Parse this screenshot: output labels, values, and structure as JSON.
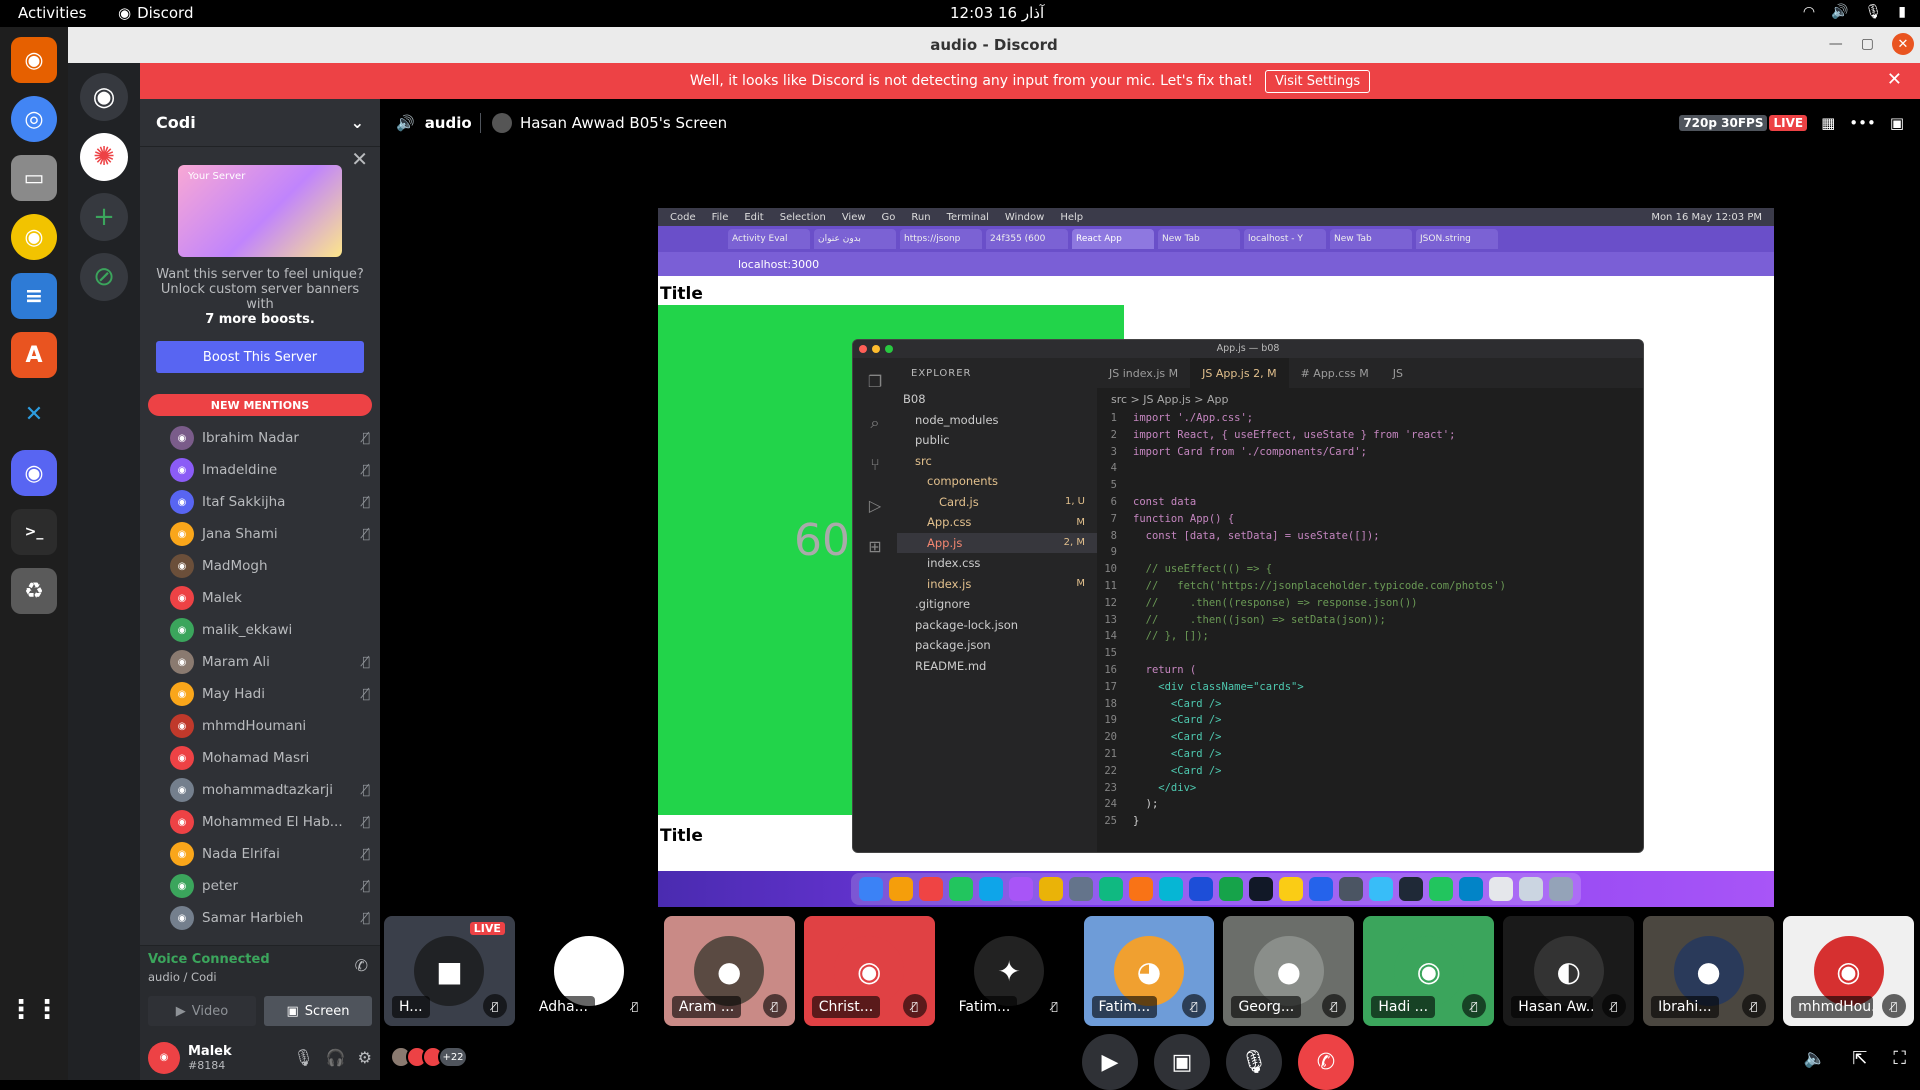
{
  "topbar": {
    "activities": "Activities",
    "app": "Discord",
    "clock": "12:03  16 آذار"
  },
  "window": {
    "title": "audio - Discord"
  },
  "notice": {
    "text": "Well, it looks like Discord is not detecting any input from your mic. Let's fix that!",
    "button": "Visit Settings"
  },
  "server": {
    "name": "Codi"
  },
  "boost": {
    "art_label": "Your Server",
    "line1": "Want this server to feel unique?",
    "line2": "Unlock custom server banners with",
    "line3": "7 more boosts.",
    "button": "Boost This Server"
  },
  "mentions": {
    "label": "NEW MENTIONS"
  },
  "users": [
    {
      "name": "Ibrahim Nadar",
      "color": "#7a5c8a",
      "muted": true
    },
    {
      "name": "Imadeldine",
      "color": "#8b5cf6",
      "muted": true
    },
    {
      "name": "Itaf Sakkijha",
      "color": "#5865f2",
      "muted": true
    },
    {
      "name": "Jana Shami",
      "color": "#faa61a",
      "muted": true
    },
    {
      "name": "MadMogh",
      "color": "#6b4f3a",
      "muted": false
    },
    {
      "name": "Malek",
      "color": "#ed4245",
      "muted": false
    },
    {
      "name": "malik_ekkawi",
      "color": "#3ba55c",
      "muted": false
    },
    {
      "name": "Maram Ali",
      "color": "#8a7a70",
      "muted": true
    },
    {
      "name": "May Hadi",
      "color": "#faa61a",
      "muted": true
    },
    {
      "name": "mhmdHoumani",
      "color": "#c0392b",
      "muted": false
    },
    {
      "name": "Mohamad Masri",
      "color": "#ed4245",
      "muted": false
    },
    {
      "name": "mohammadtazkarji",
      "color": "#747f8d",
      "muted": true
    },
    {
      "name": "Mohammed El Hab...",
      "color": "#ed4245",
      "muted": true
    },
    {
      "name": "Nada Elrifai",
      "color": "#faa61a",
      "muted": true
    },
    {
      "name": "peter",
      "color": "#3ba55c",
      "muted": true
    },
    {
      "name": "Samar Harbieh",
      "color": "#747f8d",
      "muted": true
    }
  ],
  "voice": {
    "status": "Voice Connected",
    "channel": "audio / Codi",
    "video": "Video",
    "screen": "Screen"
  },
  "me": {
    "name": "Malek",
    "tag": "#8184"
  },
  "stage": {
    "channel": "audio",
    "screen_title": "Hasan Awwad B05's Screen",
    "quality": "720p 30FPS",
    "live": "LIVE"
  },
  "shared": {
    "mac_menu": [
      "Code",
      "File",
      "Edit",
      "Selection",
      "View",
      "Go",
      "Run",
      "Terminal",
      "Window",
      "Help"
    ],
    "mac_time": "Mon 16 May  12:03 PM",
    "tabs": [
      "Activity Eval",
      "بدون عنوان",
      "https://jsonp",
      "24f355 (600",
      "React App",
      "New Tab",
      "localhost - Y",
      "New Tab",
      "JSON.string"
    ],
    "url": "localhost:3000",
    "page_title": "Title",
    "green_text": "600",
    "vscode_title": "App.js — b08",
    "explorer_header": "EXPLORER",
    "files": [
      {
        "name": "B08",
        "indent": 0,
        "badge": "",
        "color": "#ccc"
      },
      {
        "name": "node_modules",
        "indent": 1,
        "badge": "",
        "color": "#ccc"
      },
      {
        "name": "public",
        "indent": 1,
        "badge": "",
        "color": "#ccc"
      },
      {
        "name": "src",
        "indent": 1,
        "badge": "",
        "color": "#e2c08d"
      },
      {
        "name": "components",
        "indent": 2,
        "badge": "",
        "color": "#e2c08d"
      },
      {
        "name": "Card.js",
        "indent": 3,
        "badge": "1, U",
        "color": "#e2c08d"
      },
      {
        "name": "App.css",
        "indent": 2,
        "badge": "M",
        "color": "#e2c08d"
      },
      {
        "name": "App.js",
        "indent": 2,
        "badge": "2, M",
        "color": "#f48771"
      },
      {
        "name": "index.css",
        "indent": 2,
        "badge": "",
        "color": "#ccc"
      },
      {
        "name": "index.js",
        "indent": 2,
        "badge": "M",
        "color": "#e2c08d"
      },
      {
        "name": ".gitignore",
        "indent": 1,
        "badge": "",
        "color": "#ccc"
      },
      {
        "name": "package-lock.json",
        "indent": 1,
        "badge": "",
        "color": "#ccc"
      },
      {
        "name": "package.json",
        "indent": 1,
        "badge": "",
        "color": "#ccc"
      },
      {
        "name": "README.md",
        "indent": 1,
        "badge": "",
        "color": "#ccc"
      }
    ],
    "editor_tabs": [
      "JS index.js M",
      "JS App.js 2, M",
      "# App.css M",
      "JS"
    ],
    "breadcrumb": "src > JS App.js > App",
    "code": [
      "import './App.css';",
      "import React, { useEffect, useState } from 'react';",
      "import Card from './components/Card';",
      "",
      "",
      "const data",
      "function App() {",
      "  const [data, setData] = useState([]);",
      "",
      "  // useEffect(() => {",
      "  //   fetch('https://jsonplaceholder.typicode.com/photos')",
      "  //     .then((response) => response.json())",
      "  //     .then((json) => setData(json));",
      "  // }, []);",
      "",
      "  return (",
      "    <div className=\"cards\">",
      "      <Card />",
      "      <Card />",
      "      <Card />",
      "      <Card />",
      "      <Card />",
      "    </div>",
      "  );",
      "}"
    ]
  },
  "tiles": [
    {
      "label": "H...",
      "bg": "#3a3f4a",
      "face": "#202225",
      "icon": "■",
      "live": "LIVE"
    },
    {
      "label": "Adha...",
      "bg": "#000000",
      "face": "#ffffff",
      "icon": "☺"
    },
    {
      "label": "Aram ...",
      "bg": "#c98a86",
      "face": "#5a4a42",
      "icon": "●"
    },
    {
      "label": "Christ...",
      "bg": "#e04144",
      "face": "#e04144",
      "icon": "◉"
    },
    {
      "label": "Fatim...",
      "bg": "#000000",
      "face": "#222222",
      "icon": "✦"
    },
    {
      "label": "Fatim...",
      "bg": "#6e9cd8",
      "face": "#f0a030",
      "icon": "◕"
    },
    {
      "label": "Georg...",
      "bg": "#6b6e6a",
      "face": "#8a8e8a",
      "icon": "●"
    },
    {
      "label": "Hadi ...",
      "bg": "#3ba55c",
      "face": "#3ba55c",
      "icon": "◉"
    },
    {
      "label": "Hasan Aw...",
      "bg": "#1a1a1a",
      "face": "#333333",
      "icon": "◐"
    },
    {
      "label": "Ibrahi...",
      "bg": "#4b4740",
      "face": "#2a3a5a",
      "icon": "●"
    },
    {
      "label": "mhmdHou...",
      "bg": "#f0f0f0",
      "face": "#d63030",
      "icon": "◉"
    }
  ],
  "participants": {
    "more": "+22"
  }
}
